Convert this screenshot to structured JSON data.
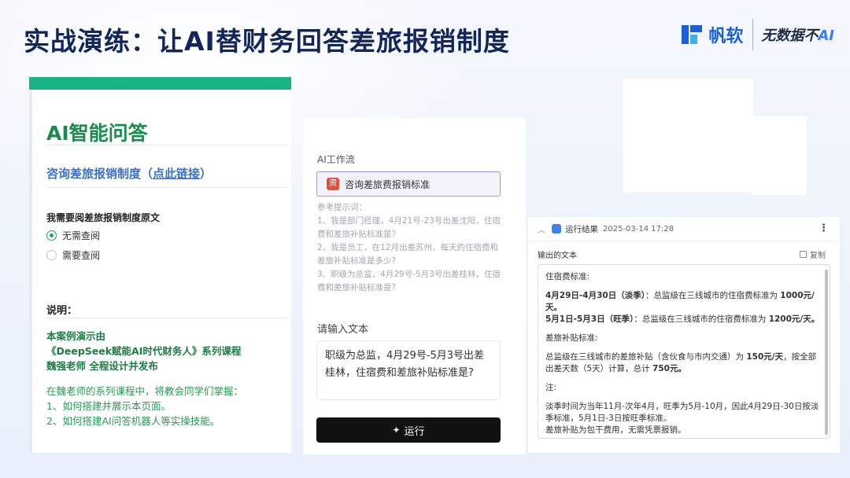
{
  "slide": {
    "title": "实战演练：让AI替财务回答差旅报销制度",
    "brand_name": "帆软",
    "slogan_main": "无数据不",
    "slogan_ai": "AI"
  },
  "left": {
    "qa_title": "AI智能问答",
    "consult_text": "咨询差旅报销制度（",
    "consult_link": "点此链接",
    "consult_close": "）",
    "radio_question": "我需要阅差旅报销制度原文",
    "radio_options": [
      "无需查阅",
      "需要查阅"
    ],
    "explain_title": "说明：",
    "demo_lines": [
      "本案例演示由",
      "《DeepSeek赋能AI时代财务人》系列课程",
      "魏强老师 全程设计并发布"
    ],
    "learn_lines": [
      "在魏老师的系列课程中，将教会同学们掌握：",
      "1、如何搭建并展示本页面。",
      "2、如何搭建AI问答机器人等实操技能。"
    ]
  },
  "middle": {
    "workflow_label": "AI工作流",
    "workflow_name": "咨询差旅费报销标准",
    "workflow_icon": "workflow-icon",
    "hint_title": "参考提示词：",
    "hints": [
      "1、我是部门经理，4月21号-23号出差沈阳，住宿费和差旅补贴标准是？",
      "2、我是员工，在12月出差苏州，每天的住宿费和差旅补贴标准是多少?",
      "3、职级为总监，4月29号-5月3号出差桂林，住宿费和差旅补贴标准是?"
    ],
    "input_label": "请输入文本",
    "input_value": "职级为总监，4月29号-5月3号出差桂林，住宿费和差旅补贴标准是?",
    "run_label": "运行"
  },
  "result": {
    "title": "运行结果",
    "time": "2025-03-14 17:28",
    "output_label": "输出的文本",
    "copy_label": "复制",
    "lodging_title": "住宿费标准:",
    "lodging1_bold": "4月29日-4月30日（淡季）",
    "lodging1_text": "：总监级在三线城市的住宿费标准为 ",
    "lodging1_amount": "1000元/天。",
    "lodging2_bold": "5月1日-5月3日（旺季）",
    "lodging2_text": "：总监级在三线城市的住宿费标准为 ",
    "lodging2_amount": "1200元/天。",
    "allow_title": "差旅补贴标准:",
    "allow_pre": "总监级在三线城市的差旅补贴（含伙食与市内交通）为 ",
    "allow_rate": "150元/天",
    "allow_mid": "，按全部出差天数（5天）计算，总计 ",
    "allow_total": "750元。",
    "note_title": "注:",
    "note1": "淡季时间为当年11月-次年4月，旺季为5月-10月，因此4月29日-30日按淡季标准，5月1日-3日按旺季标准。",
    "note2": "差旅补贴为包干费用，无需凭票报销。"
  }
}
